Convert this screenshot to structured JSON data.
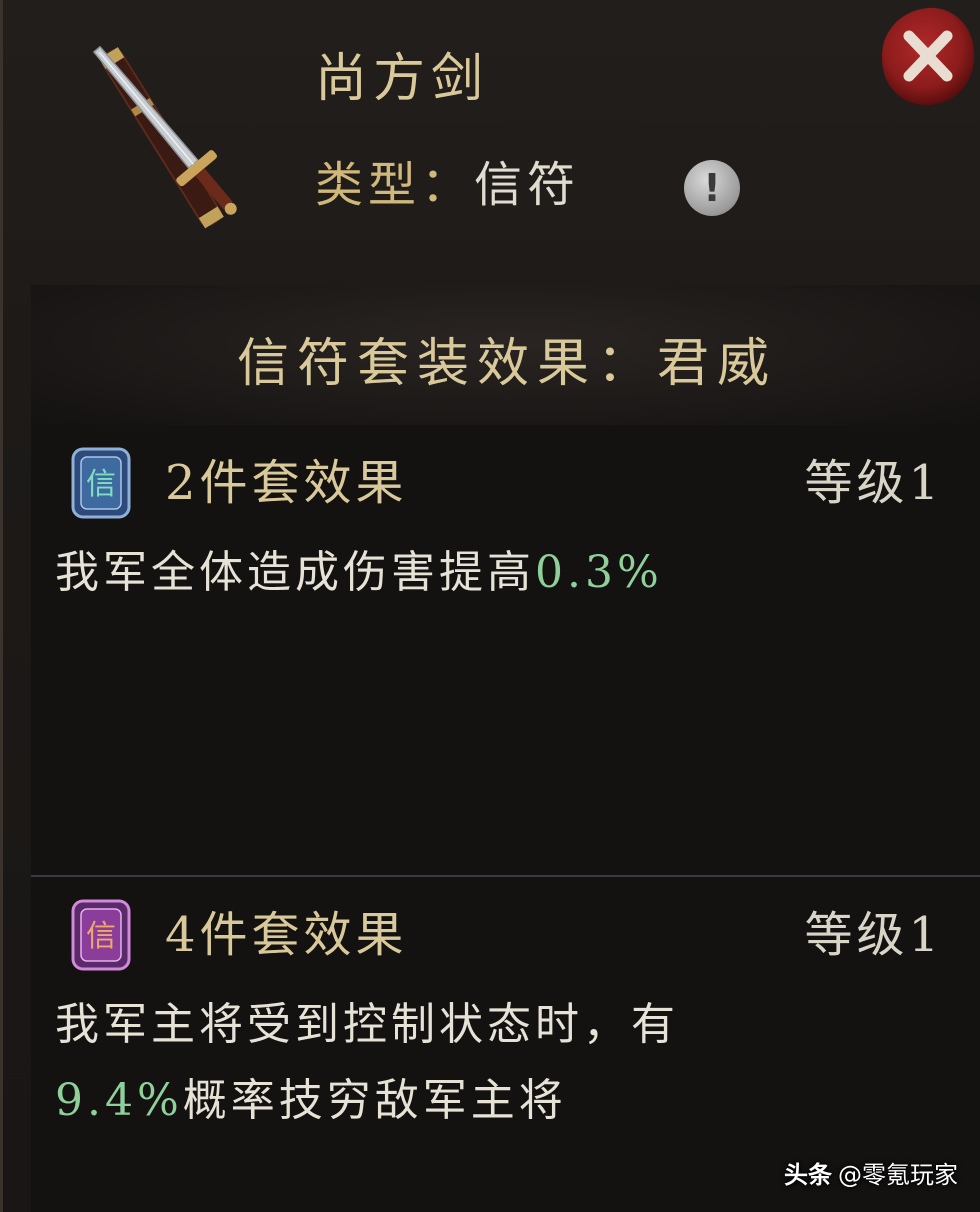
{
  "item": {
    "name": "尚方剑",
    "type_label": "类型：",
    "type_value": "信符",
    "icon": "sword-icon"
  },
  "header": {
    "info_icon": "exclamation-icon",
    "info_symbol": "!",
    "close_icon": "close-icon"
  },
  "set_effect": {
    "title": "信符套装效果：君威",
    "tiers": [
      {
        "badge_icon": "blue-token-badge-icon",
        "badge_char": "信",
        "title": "2件套效果",
        "level": "等级1",
        "desc_prefix": "我军全体造成伤害提高",
        "desc_value": "0.3%",
        "desc_suffix": ""
      },
      {
        "badge_icon": "purple-token-badge-icon",
        "badge_char": "信",
        "title": "4件套效果",
        "level": "等级1",
        "desc_prefix": "我军主将受到控制状态时，有",
        "desc_value": "9.4%",
        "desc_suffix": "概率技穷敌军主将"
      }
    ]
  },
  "colors": {
    "gold_text": "#d9c99a",
    "highlight_green": "#8fcf9a",
    "close_red": "#8c1c1c"
  },
  "watermark": {
    "brand": "头条",
    "handle": "@零氪玩家"
  }
}
